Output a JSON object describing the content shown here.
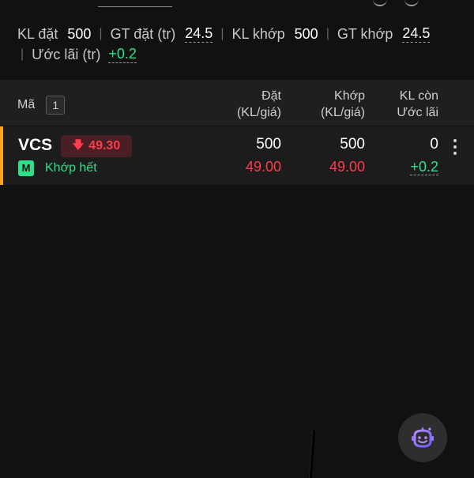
{
  "summary": {
    "kl_dat_label": "KL đặt",
    "kl_dat_value": "500",
    "gt_dat_label": "GT đặt (tr)",
    "gt_dat_value": "24.5",
    "kl_khop_label": "KL khớp",
    "kl_khop_value": "500",
    "gt_khop_label": "GT khớp",
    "gt_khop_value": "24.5",
    "uoc_lai_label": "Ước lãi (tr)",
    "uoc_lai_value": "+0.2",
    "separator": "|"
  },
  "table_header": {
    "ma_label": "Mã",
    "count": "1",
    "dat_line1": "Đặt",
    "dat_line2": "(KL/giá)",
    "khop_line1": "Khớp",
    "khop_line2": "(KL/giá)",
    "klcon_line1": "KL còn",
    "klcon_line2": "Ước lãi"
  },
  "orders": [
    {
      "symbol": "VCS",
      "price_change": "49.30",
      "type_badge": "M",
      "status": "Khớp hết",
      "dat_qty": "500",
      "dat_price": "49.00",
      "khop_qty": "500",
      "khop_price": "49.00",
      "kl_con": "0",
      "uoc_lai": "+0.2"
    }
  ],
  "colors": {
    "background": "#111111",
    "up": "#2ee08a",
    "down": "#ff3b4d",
    "accent": "#f5a623"
  },
  "icons": {
    "arrow": "arrow-down-icon",
    "menu": "kebab-menu-icon",
    "assistant": "robot-assistant-icon"
  }
}
